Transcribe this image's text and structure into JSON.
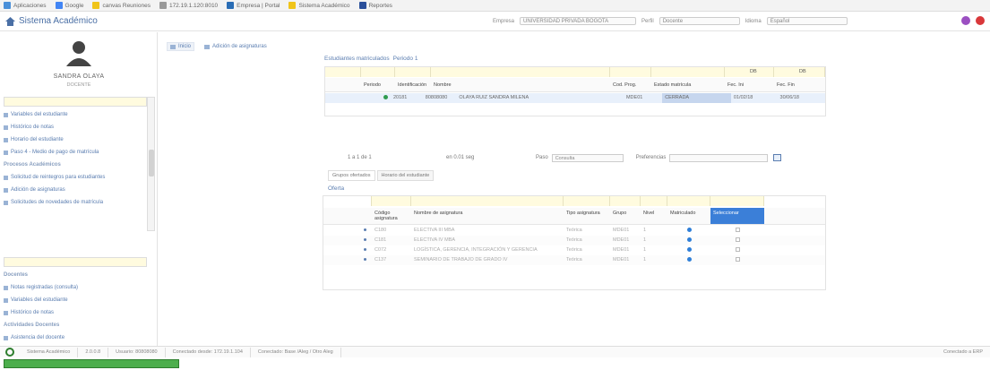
{
  "bookmarks": [
    {
      "label": "Aplicaciones",
      "color": "#4a90d9"
    },
    {
      "label": "Google",
      "color": "#4285f4"
    },
    {
      "label": "canvas Reuniones",
      "color": "#f0c419"
    },
    {
      "label": "172.19.1.120:8010",
      "color": "#999999"
    },
    {
      "label": "Empresa | Portal",
      "color": "#2a6db5"
    },
    {
      "label": "Sistema Académico",
      "color": "#f0c419"
    },
    {
      "label": "Reportes",
      "color": "#2a4f9a"
    }
  ],
  "header": {
    "title": "Sistema Académico",
    "empresa_label": "Empresa",
    "empresa_value": "UNIVERSIDAD PRIVADA BOGOTA",
    "perfil_label": "Perfil",
    "perfil_value": "Docente",
    "idioma_label": "Idioma",
    "idioma_value": "Español"
  },
  "profile": {
    "name": "SANDRA OLAYA",
    "role": "DOCENTE"
  },
  "sidebar": {
    "items": [
      {
        "label": "Variables del estudiante",
        "type": "item"
      },
      {
        "label": "Histórico de notas",
        "type": "item"
      },
      {
        "label": "Horario del estudiante",
        "type": "item"
      },
      {
        "label": "Paso 4 - Medio de pago de matrícula",
        "type": "item"
      },
      {
        "label": "Procesos Académicos",
        "type": "section"
      },
      {
        "label": "Solicitud de reintegros para estudiantes",
        "type": "item"
      },
      {
        "label": "Adición de asignaturas",
        "type": "item"
      },
      {
        "label": "Solicitudes de novedades de matrícula",
        "type": "item"
      }
    ],
    "items2": [
      {
        "label": "Docentes",
        "type": "section"
      },
      {
        "label": "Notas registradas (consulta)",
        "type": "item"
      },
      {
        "label": "Variables del estudiante",
        "type": "item"
      },
      {
        "label": "Histórico de notas",
        "type": "item"
      },
      {
        "label": "Actividades Docentes",
        "type": "section"
      },
      {
        "label": "Asistencia del docente",
        "type": "item"
      }
    ]
  },
  "tabs": [
    {
      "label": "Inicio",
      "active": true
    },
    {
      "label": "Adición de asignaturas",
      "active": false
    }
  ],
  "enrolled": {
    "title": "Estudiantes matriculados",
    "period_label": "Periodo 1",
    "filter_values": {
      "fec_ini": "DB",
      "fec_fin": "DB"
    },
    "columns": [
      "Periodo",
      "Identificación",
      "Nombre",
      "Cod. Prog.",
      "Estado matrícula",
      "Fec. Ini",
      "Fec. Fin"
    ],
    "rows": [
      [
        "20181",
        "80808080",
        "OLAYA RUIZ SANDRA MILENA",
        "MDE01",
        "CERRADA",
        "01/02/18",
        "30/06/18"
      ]
    ]
  },
  "pager": {
    "range": "1 a 1 de 1",
    "time": "en 0.01 seg",
    "paso_label": "Paso",
    "paso_value": "Consulta",
    "preferences_label": "Preferencias"
  },
  "subtabs": [
    {
      "label": "Grupos ofertados",
      "active": true
    },
    {
      "label": "Horario del estudiante",
      "active": false
    }
  ],
  "offer": {
    "title": "Oferta",
    "columns": [
      "Código asignatura",
      "Nombre de asignatura",
      "Tipo asignatura",
      "Grupo",
      "Nivel",
      "Matriculado",
      "Seleccionar"
    ],
    "rows": [
      [
        "C180",
        "ELECTIVA III MBA",
        "Teórica",
        "MDE01",
        "1"
      ],
      [
        "C181",
        "ELECTIVA IV MBA",
        "Teórica",
        "MDE01",
        "1"
      ],
      [
        "C072",
        "LOGÍSTICA, GERENCIA, INTEGRACIÓN Y GERENCIA",
        "Teórica",
        "MDE01",
        "1"
      ],
      [
        "C137",
        "SEMINARIO DE TRABAJO DE GRADO IV",
        "Teórica",
        "MDE01",
        "1"
      ]
    ]
  },
  "footer": {
    "segments": [
      "Sistema Académico",
      "2.0.0.8",
      "Usuario: 80808080",
      "Conectado desde: 172.19.1.104",
      "Conectado: Base /Aleg / Otro Aleg",
      "Conectado a ERP"
    ]
  },
  "progress": {
    "fraction": 1.0
  }
}
